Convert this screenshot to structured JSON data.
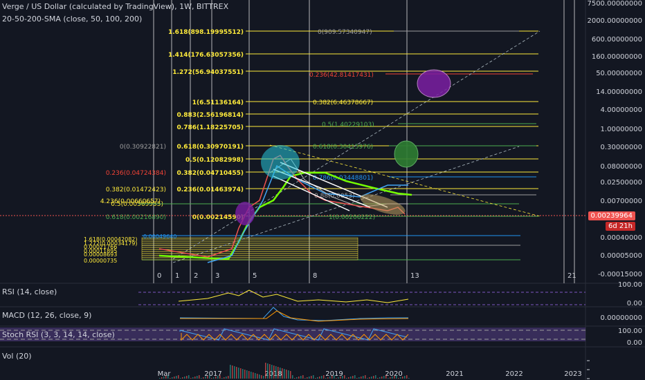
{
  "header": {
    "title": "Verge / US Dollar (calculated by TradingView), 1W, BITTREX",
    "indicator": "20-50-200-SMA (close, 50, 100, 200)"
  },
  "colors": {
    "background": "#131722",
    "price_line": "#ef5350",
    "fib_yellow": "#ffeb3b",
    "fib_green": "#4caf50",
    "fib_blue": "#2196f3",
    "fib_gray": "#9e9e9e",
    "fib_red": "#f44336",
    "sma_green": "#76ff03",
    "sma_blue": "#42a5f5",
    "sma_gray": "#bdbdbd",
    "purple": "#7b1fa2",
    "cyan": "#26c6da",
    "rsi_band": "#7e57c2"
  },
  "price_axis": {
    "labels": [
      "7500.00000000",
      "2000.00000000",
      "600.00000000",
      "160.00000000",
      "50.00000000",
      "14.00000000",
      "4.00000000",
      "1.00000000",
      "0.30000000",
      "0.08000000",
      "0.02500000",
      "0.00700000",
      "0.00040000",
      "0.00005000",
      "-0.00015000"
    ],
    "current_price": "0.00239964",
    "countdown": "6d 21h"
  },
  "rsi_axis": {
    "labels": [
      "100.00",
      "0.00"
    ]
  },
  "macd_axis": {
    "labels": [
      "0.00000000"
    ]
  },
  "stoch_axis": {
    "labels": [
      "100.00",
      "0.00"
    ]
  },
  "time_axis": {
    "labels": [
      "Mar",
      "2017",
      "2018",
      "2019",
      "2020",
      "2021",
      "2022",
      "2023"
    ]
  },
  "wave_labels": [
    "0",
    "1",
    "2",
    "3",
    "5",
    "8",
    "13",
    "21"
  ],
  "fib_left": [
    "1.618(898.19995512)",
    "1.414(176.63057356)",
    "1.272(56.94037551)",
    "1(6.51136164)",
    "0.883(2.56196814)",
    "0.786(1.18225705)",
    "0.618(0.30970191)",
    "0.5(0.12082998)",
    "0.382(0.04710455)",
    "0.236(0.01463974)",
    "0(0.00214590)"
  ],
  "fib_outer": [
    "0(0.30922821)",
    "0.236(0.04724384)",
    "0.382(0.01472423)",
    "4.236(0.00660657)",
    "0.5(0.00569955)",
    "0.618(0.00216890)"
  ],
  "fib_right": [
    "0(909.57340947)",
    "0.236(42.81417431)",
    "0.382(6.46378667)",
    "0.5(1.40229103)",
    "0.618(0.30415976)",
    "0.786(0.03448801)",
    "0.88(0.0053)",
    "1(0.00206222)"
  ],
  "fib_small": [
    "0.00049640",
    "1.618(0.00042082)",
    "1.272(0.00034179)",
    "0.00021766",
    "0.00011895",
    "0.00008693",
    "0.00000735"
  ],
  "panes": {
    "rsi": "RSI (14, close)",
    "macd": "MACD (12, 26, close, 9)",
    "stoch": "Stoch RSI (3, 3, 14, 14, close)",
    "vol": "Vol (20)"
  }
}
